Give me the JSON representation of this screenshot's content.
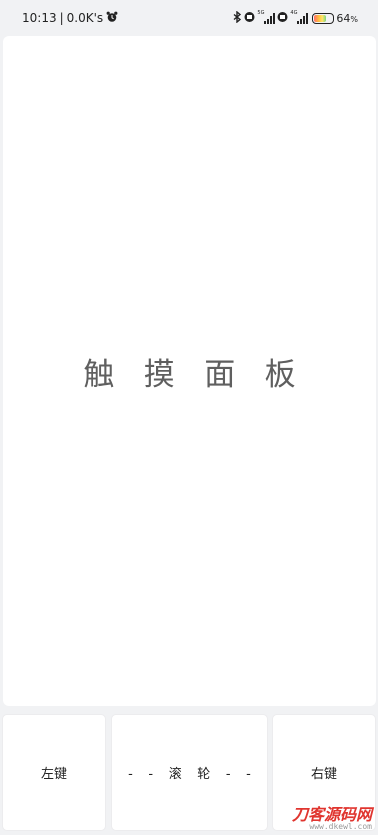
{
  "status_bar": {
    "time": "10:13",
    "separator": "|",
    "net_speed": "0.0K's",
    "sim1_tag": "5G",
    "sim2_tag": "4G",
    "battery": "64",
    "battery_unit": "%"
  },
  "touchpad": {
    "label": "触摸面板"
  },
  "buttons": {
    "left": "左键",
    "wheel": "--滚轮--",
    "right": "右键"
  },
  "watermark": {
    "main": "刀客源码网",
    "url": "www.dkewl.com"
  },
  "icons": {
    "alarm": "alarm-clock-icon",
    "bluetooth": "bluetooth-icon",
    "hd": "hd-icon"
  }
}
